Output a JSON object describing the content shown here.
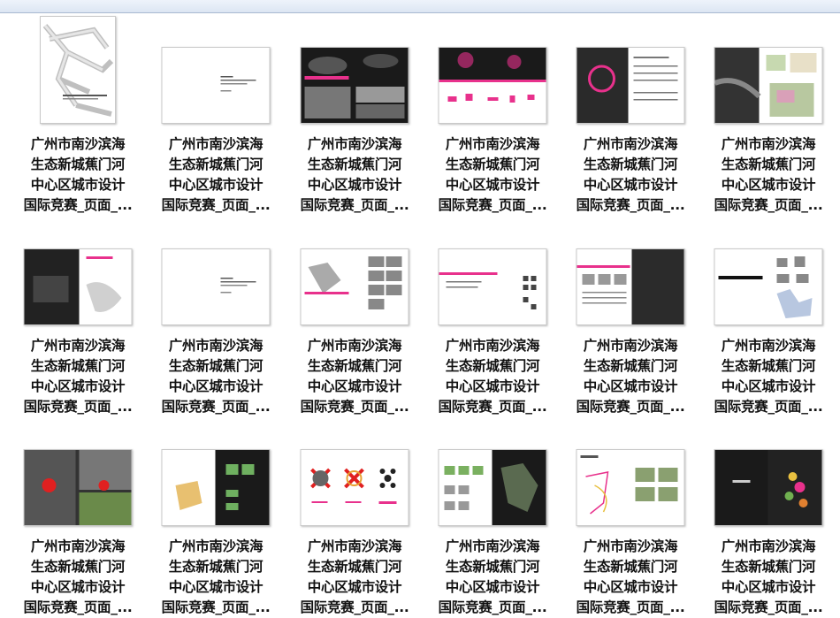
{
  "caption": "广州市南沙滨海\n生态新城蕉门河\n中心区城市设计\n国际竞赛_页面_...",
  "colors": {
    "accent": "#e8318c",
    "dark": "#1a1a1a",
    "selectionBar": "#dce6f3"
  },
  "items": [
    {
      "style": "map-portrait"
    },
    {
      "style": "white-text"
    },
    {
      "style": "dark-photos"
    },
    {
      "style": "pink-band"
    },
    {
      "style": "dark-text"
    },
    {
      "style": "aerial-collage"
    },
    {
      "style": "night-map"
    },
    {
      "style": "white-text"
    },
    {
      "style": "pink-diagrams"
    },
    {
      "style": "pink-list"
    },
    {
      "style": "text-dark-map"
    },
    {
      "style": "diagram-black"
    },
    {
      "style": "photo-collage"
    },
    {
      "style": "diagram-dark"
    },
    {
      "style": "red-x"
    },
    {
      "style": "plans-dark"
    },
    {
      "style": "map-photos"
    },
    {
      "style": "tod-dark"
    }
  ]
}
